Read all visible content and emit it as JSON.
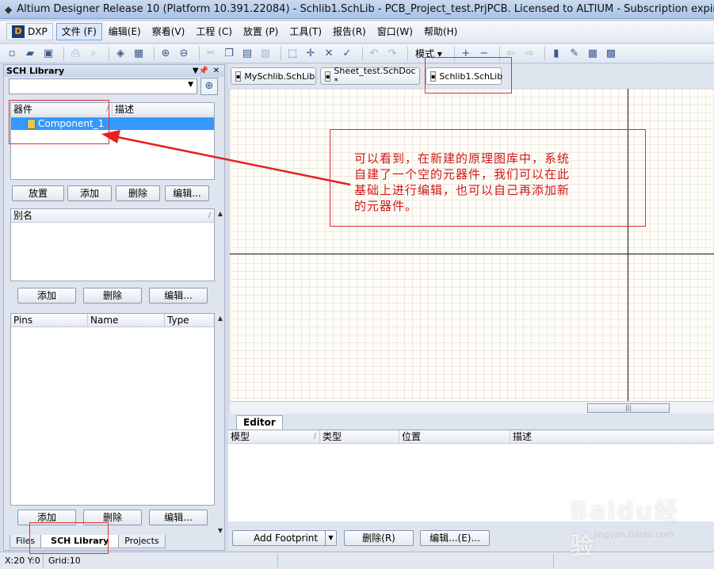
{
  "window": {
    "title": "Altium Designer Release 10 (Platform 10.391.22084) - Schlib1.SchLib - PCB_Project_test.PrjPCB. Licensed to ALTIUM - Subscription expired. Not signed in."
  },
  "menubar": {
    "dxp": "DXP",
    "items": [
      "文件 (F)",
      "编辑(E)",
      "察看(V)",
      "工程 (C)",
      "放置 (P)",
      "工具(T)",
      "报告(R)",
      "窗口(W)",
      "帮助(H)"
    ]
  },
  "toolbar": {
    "mode_label": "模式"
  },
  "panel": {
    "title": "SCH Library",
    "components": {
      "columns": [
        "器件",
        "描述"
      ],
      "rows": [
        {
          "name": "Component_1",
          "description": ""
        }
      ],
      "buttons": [
        "放置",
        "添加",
        "删除",
        "编辑..."
      ]
    },
    "aliases": {
      "columns": [
        "别名"
      ],
      "buttons": [
        "添加",
        "删除",
        "编辑..."
      ]
    },
    "pins": {
      "columns": [
        "Pins",
        "Name",
        "Type"
      ],
      "buttons": [
        "添加",
        "删除",
        "编辑..."
      ]
    },
    "tabs": [
      "Files",
      "SCH Library",
      "Projects"
    ]
  },
  "document_tabs": [
    "MySchlib.SchLib",
    "Sheet_test.SchDoc *",
    "Schlib1.SchLib"
  ],
  "editor": {
    "tab": "Editor",
    "columns": [
      "模型",
      "类型",
      "位置",
      "描述"
    ],
    "buttons": {
      "add_footprint": "Add Footprint",
      "delete": "删除(R)",
      "edit": "编辑...(E)..."
    }
  },
  "statusbar": {
    "coords": "X:20 Y:0",
    "grid": "Grid:10"
  },
  "annotation": {
    "lines": [
      "可以看到，在新建的原理图库中，系统",
      "自建了一个空的元器件，我们可以在此",
      "基础上进行编辑，也可以自己再添加新",
      "的元器件。"
    ],
    "color": "#d01818"
  },
  "watermark": {
    "brand": "Baidu经验",
    "url": "jingyan.baidu.com"
  }
}
